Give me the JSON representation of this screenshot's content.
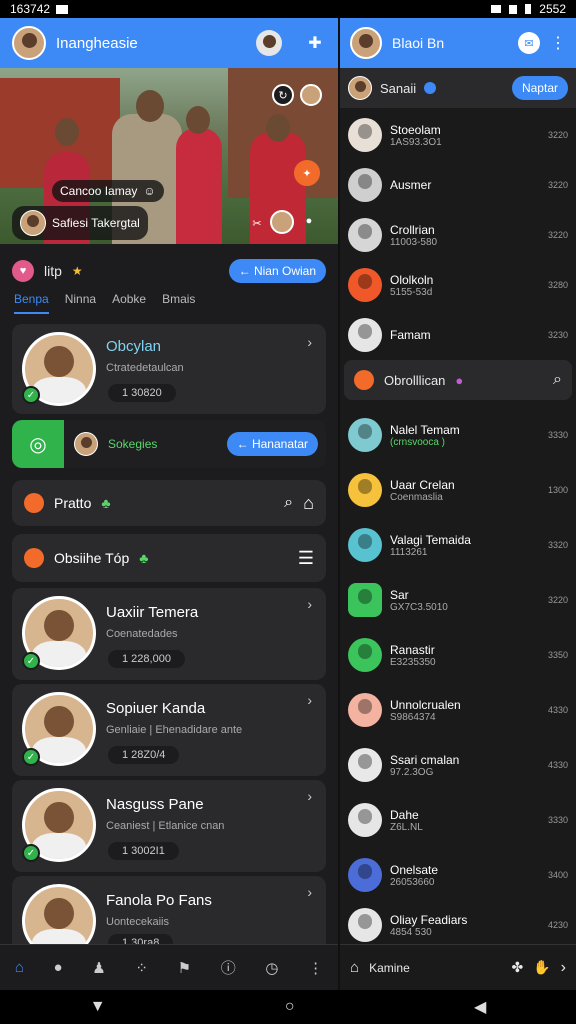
{
  "status": {
    "time": "163742",
    "battery": "2552"
  },
  "left": {
    "header": {
      "title": "Inangheasie"
    },
    "photo": {
      "chip1": "Cancoo Iamay",
      "chip2": "Safiesi Takergtal"
    },
    "section": {
      "title": "litp",
      "button": "Nian Owian"
    },
    "tabs": [
      "Benpa",
      "Ninna",
      "Aobke",
      "Bmais"
    ],
    "featured": {
      "name": "Obcylan",
      "sub": "Ctratedetaulcan",
      "chip": "1 30820"
    },
    "promo": {
      "label": "Sokegies",
      "button": "Hananatar"
    },
    "search_bar": {
      "label": "Pratto"
    },
    "list_header": {
      "label": "Obsiihe Tóp"
    },
    "contacts": [
      {
        "name": "Uaxiir Temera",
        "sub": "Coenatedades",
        "chip": "1 228,000"
      },
      {
        "name": "Sopiuer Kanda",
        "sub": "Genliaie | Ehenadidare ante",
        "chip": "1 28Z0/4"
      },
      {
        "name": "Nasguss Pane",
        "sub": "Ceaniest | Etlanice cnan",
        "chip": "1 3002I1"
      },
      {
        "name": "Fanola Po Fans",
        "sub": "Uontecekaiis",
        "chip": "1 30ra8"
      }
    ]
  },
  "right": {
    "header": {
      "title": "Blaoi Bn"
    },
    "sub": {
      "label": "Sanaii",
      "button": "Naptar"
    },
    "rows_top": [
      {
        "name": "Stoeolam",
        "sub": "1AS93.3O1",
        "time": "3220",
        "color": "#e8e0d6"
      },
      {
        "name": "Ausmer",
        "sub": "",
        "time": "3220",
        "color": "#cfcfcf"
      },
      {
        "name": "Crollrian",
        "sub": "11003-580",
        "time": "3220",
        "color": "#d6d6d6"
      },
      {
        "name": "Ololkoln",
        "sub": "5155-53d",
        "time": "3280",
        "color": "#f0582a"
      },
      {
        "name": "Famam",
        "sub": "",
        "time": "3230",
        "color": "#e6e6e6"
      }
    ],
    "group": {
      "label": "Obrolllican"
    },
    "rows_bottom": [
      {
        "name": "Nalel Temam",
        "sub": "(crnsvooca )",
        "time": "3330",
        "color": "#7fc9d0"
      },
      {
        "name": "Uaar Crelan",
        "sub": "Coenmaslia",
        "time": "1300",
        "color": "#f6c23b"
      },
      {
        "name": "Valagi Temaida",
        "sub": "1113261",
        "time": "3320",
        "color": "#59c2d0"
      },
      {
        "name": "Sar",
        "sub": "GX7C3.5010",
        "time": "3220",
        "color": "#3cc45c"
      },
      {
        "name": "Ranastir",
        "sub": "E3235350",
        "time": "3350",
        "color": "#3cc45c"
      },
      {
        "name": "Unnolcrualen",
        "sub": "S9864374",
        "time": "4330",
        "color": "#f4b2a0"
      },
      {
        "name": "Ssari cmalan",
        "sub": "97.2.3OG",
        "time": "4330",
        "color": "#e8e8e8"
      },
      {
        "name": "Dahe",
        "sub": "Z6L.NL",
        "time": "3330",
        "color": "#e6e6e6"
      },
      {
        "name": "Onelsate",
        "sub": "26053660",
        "time": "3400",
        "color": "#4c6cd8"
      },
      {
        "name": "Oliay Feadiars",
        "sub": "4854 530",
        "time": "4230",
        "color": "#e6e6e6"
      }
    ],
    "bottom": {
      "label": "Kamine"
    }
  }
}
